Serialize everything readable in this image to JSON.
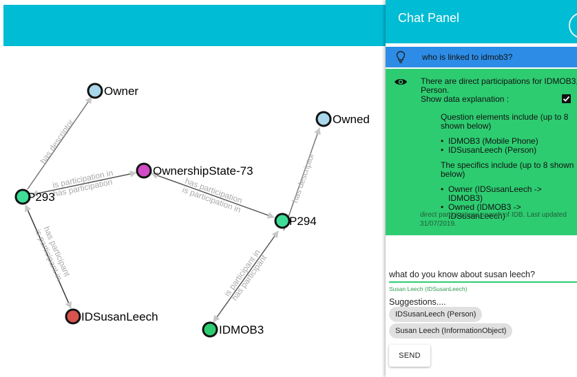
{
  "colors": {
    "header": "#00bcd4",
    "question_bg": "#2d8de6",
    "answer_bg": "#2ecc71",
    "node_owner": "#a8d8ea",
    "node_participant": "#3ddc97",
    "node_state": "#d14bc6",
    "node_person": "#d9534f",
    "node_device": "#2ecc71"
  },
  "graph": {
    "nodes": {
      "owner": "Owner",
      "owned": "Owned",
      "ownership_state": "OwnershipState-73",
      "p293": "P293",
      "p294": "P294",
      "idsusanleech": "IDSusanLeech",
      "idmob3": "IDMOB3"
    },
    "edges": {
      "has_descriptor": "has descriptor",
      "is_participation_in": "is participation in",
      "has_participation": "has participation",
      "has_participant": "has participant",
      "is_participant_in": "is participant in"
    }
  },
  "chat": {
    "title": "Chat Panel",
    "question_icon": "lightbulb-icon",
    "question": "who is linked to idmob3?",
    "answer_icon": "eye-icon",
    "answer_intro": "There are direct participations for IDMOB3, Person.",
    "show_explanation_label": "Show data explanation :",
    "show_explanation_checked": true,
    "elements_heading": "Question elements include (up to 8 shown below)",
    "elements": [
      "IDMOB3 (Mobile Phone)",
      "IDSusanLeech (Person)"
    ],
    "specifics_heading": "The specifics include (up to 8 shown below)",
    "specifics": [
      "Owner (IDSusanLeech -> IDMOB3)",
      "Owned (IDMOB3 -> IDSusanLeech)"
    ],
    "footnote": "direct participations search of IDB. Last updated 31/07/2019.",
    "input_value": "what do you know about susan leech?",
    "input_hint": "Susan Leech (IDSusanLeech)",
    "suggestions_label": "Suggestions....",
    "suggestions": [
      "IDSusanLeech (Person)",
      "Susan Leech (InformationObject)"
    ],
    "send_label": "SEND"
  }
}
